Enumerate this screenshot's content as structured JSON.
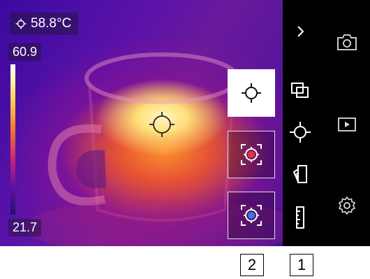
{
  "readouts": {
    "spot_temperature": "58.8°C",
    "scale_max": "60.9",
    "scale_min": "21.7"
  },
  "icons": {
    "spot_readout": "crosshair-icon",
    "center_marker": "center-spot-circle-icon",
    "collapse": "chevron-right-icon",
    "measure_spot": "crosshair-icon",
    "measure_hot": "hot-spot-icon",
    "measure_cold": "cold-spot-icon",
    "image_mode": "overlay-layers-icon",
    "measurement": "crosshair-icon",
    "palette": "palette-cards-icon",
    "scale": "ruler-icon",
    "capture": "camera-icon",
    "gallery": "play-icon",
    "settings": "gear-icon"
  },
  "colors": {
    "hot_marker": "#e8323c",
    "cold_marker": "#2f7de8"
  },
  "callouts": {
    "label_1": "1",
    "label_2": "2"
  }
}
